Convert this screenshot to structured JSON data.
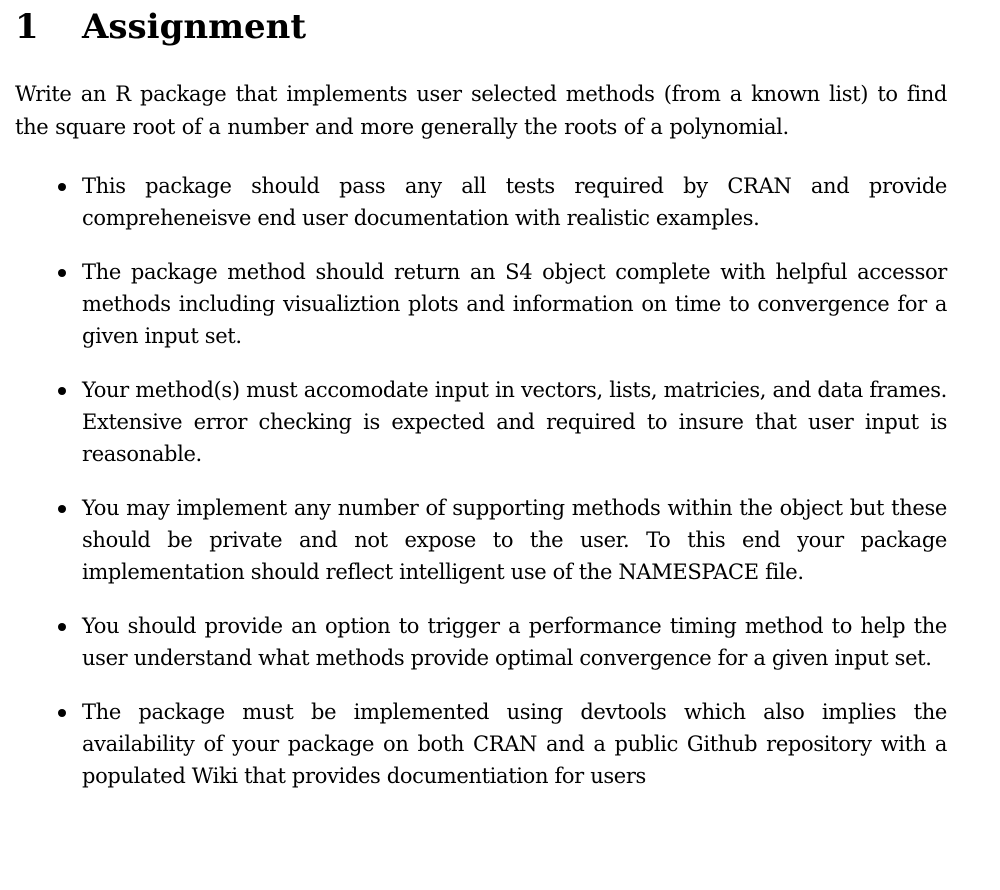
{
  "section": {
    "number": "1",
    "title": "Assignment"
  },
  "intro": "Write an R package that implements user selected methods (from a known list) to find the square root of a number and more generally the roots of a polynomial.",
  "items": [
    "This package should pass any all tests required by CRAN and provide compreheneisve end user documentation with realistic examples.",
    "The package method should return an S4 object complete with helpful accessor methods including visualiztion plots and information on time to convergence for a given input set.",
    "Your method(s) must accomodate input in vectors, lists, matricies, and data frames. Extensive error checking is expected and required to insure that user input is reasonable.",
    "You may implement any number of supporting methods within the object but these should be private and not expose to the user. To this end your package implementation should reflect intelligent use of the NAMESPACE file.",
    "You should provide an option to trigger a performance timing method to help the user understand what methods provide optimal convergence for a given input set.",
    "The package must be implemented using devtools which also implies the availability of your package on both CRAN and a public Github repository with a populated Wiki that provides documentiation for users"
  ]
}
